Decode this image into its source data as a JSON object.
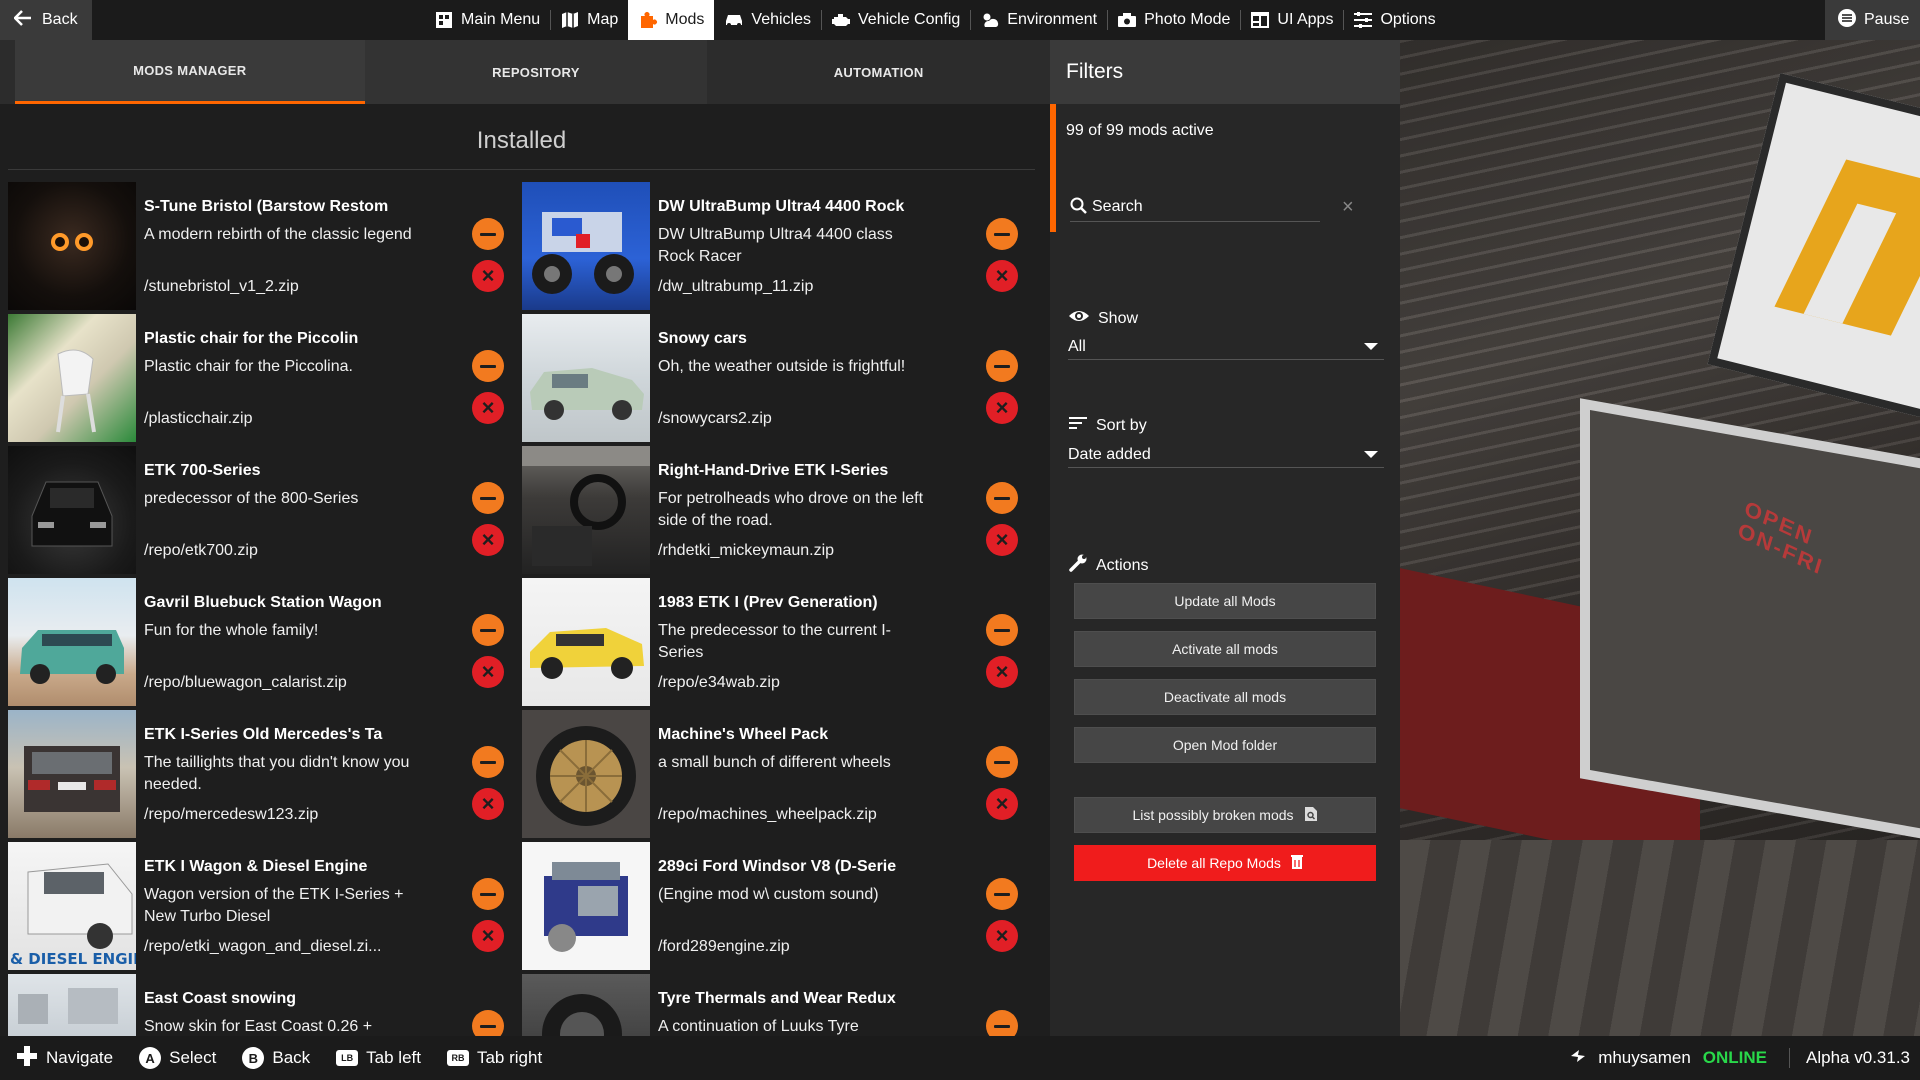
{
  "topbar": {
    "back_label": "Back",
    "pause_label": "Pause",
    "nav": [
      {
        "label": "Main Menu",
        "icon": "main-menu-icon"
      },
      {
        "label": "Map",
        "icon": "map-icon"
      },
      {
        "label": "Mods",
        "icon": "puzzle-icon",
        "active": true
      },
      {
        "label": "Vehicles",
        "icon": "car-icon"
      },
      {
        "label": "Vehicle Config",
        "icon": "engine-icon"
      },
      {
        "label": "Environment",
        "icon": "weather-icon"
      },
      {
        "label": "Photo Mode",
        "icon": "camera-icon"
      },
      {
        "label": "UI Apps",
        "icon": "ui-apps-icon"
      },
      {
        "label": "Options",
        "icon": "sliders-icon"
      }
    ]
  },
  "tabs": [
    "MODS MANAGER",
    "REPOSITORY",
    "AUTOMATION"
  ],
  "installed_title": "Installed",
  "mods": [
    {
      "title": "S-Tune Bristol (Barstow Restom",
      "desc": "A modern rebirth of the classic legend",
      "file": "/stunebristol_v1_2.zip",
      "thumb": "night-car"
    },
    {
      "title": "DW UltraBump Ultra4 4400 Rock",
      "desc": "DW UltraBump Ultra4 4400 class Rock Racer",
      "file": "/dw_ultrabump_11.zip",
      "thumb": "rock-racer"
    },
    {
      "title": "Plastic chair for the Piccolin",
      "desc": "Plastic chair for the Piccolina.",
      "file": "/plasticchair.zip",
      "thumb": "chair"
    },
    {
      "title": "Snowy cars",
      "desc": "Oh, the weather outside is frightful!",
      "file": "/snowycars2.zip",
      "thumb": "snow-car"
    },
    {
      "title": "ETK 700-Series",
      "desc": "predecessor of the 800-Series",
      "file": "/repo/etk700.zip",
      "thumb": "dark-car"
    },
    {
      "title": "Right-Hand-Drive ETK I-Series",
      "desc": "For petrolheads who drove on the left side of the road.",
      "file": "/rhdetki_mickeymaun.zip",
      "thumb": "interior"
    },
    {
      "title": "Gavril Bluebuck Station Wagon",
      "desc": "Fun for the whole family!",
      "file": "/repo/bluewagon_calarist.zip",
      "thumb": "wagon"
    },
    {
      "title": "1983 ETK I (Prev Generation)",
      "desc": "The predecessor to the current I-Series",
      "file": "/repo/e34wab.zip",
      "thumb": "yellow-car"
    },
    {
      "title": "ETK I-Series Old Mercedes's Ta",
      "desc": "The taillights that you didn't know you needed.",
      "file": "/repo/mercedesw123.zip",
      "thumb": "rear-car"
    },
    {
      "title": "Machine's Wheel Pack",
      "desc": "a small bunch of different wheels",
      "file": "/repo/machines_wheelpack.zip",
      "thumb": "wheel"
    },
    {
      "title": "ETK I Wagon & Diesel Engine",
      "desc": "Wagon version of the ETK I-Series + New Turbo Diesel",
      "file": "/repo/etki_wagon_and_diesel.zi...",
      "thumb": "diesel",
      "thumb_text": "& DIESEL ENGINE"
    },
    {
      "title": "289ci Ford Windsor V8 (D-Serie",
      "desc": "(Engine mod w\\ custom sound)",
      "file": "/ford289engine.zip",
      "thumb": "engine"
    },
    {
      "title": "East Coast snowing",
      "desc": "Snow skin for East Coast 0.26 +",
      "file": "",
      "thumb": "snow-town"
    },
    {
      "title": "Tyre Thermals and Wear Redux",
      "desc": "A continuation of Luuks Tyre",
      "file": "",
      "thumb": "tyre"
    }
  ],
  "filters": {
    "title": "Filters",
    "active_count": "99 of 99 mods active",
    "search_placeholder": "Search",
    "show_label": "Show",
    "show_value": "All",
    "sort_label": "Sort by",
    "sort_value": "Date added",
    "actions_label": "Actions",
    "actions": [
      {
        "label": "Update all Mods",
        "style": "normal"
      },
      {
        "label": "Activate all mods",
        "style": "normal"
      },
      {
        "label": "Deactivate all mods",
        "style": "normal"
      },
      {
        "label": "Open Mod folder",
        "style": "normal"
      },
      {
        "label": "List possibly broken mods",
        "style": "normal",
        "icon": "search-doc-icon"
      },
      {
        "label": "Delete all Repo Mods",
        "style": "danger",
        "icon": "trash-icon"
      }
    ]
  },
  "bottombar": {
    "hints": [
      {
        "key": "dpad",
        "label": "Navigate"
      },
      {
        "key": "A",
        "label": "Select"
      },
      {
        "key": "B",
        "label": "Back"
      },
      {
        "key": "LB",
        "label": "Tab left"
      },
      {
        "key": "RB",
        "label": "Tab right"
      }
    ],
    "username": "mhuysamen",
    "status": "ONLINE",
    "version": "Alpha v0.31.3"
  },
  "colors": {
    "accent": "#ff6600",
    "danger": "#f01c1c",
    "online": "#29d84a"
  }
}
